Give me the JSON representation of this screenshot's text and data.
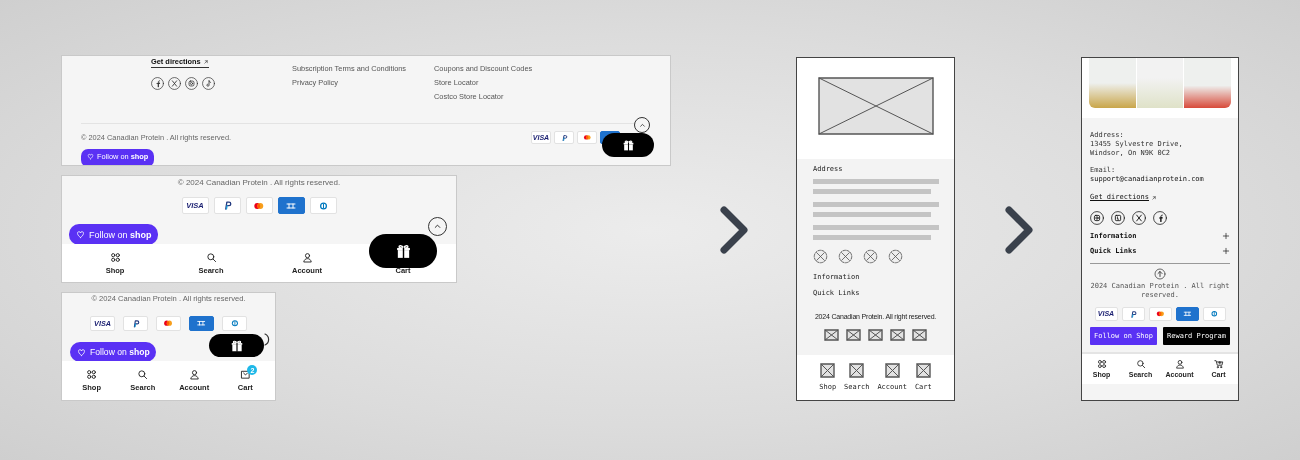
{
  "desktop_footer": {
    "get_directions": "Get directions",
    "links_column_1": [
      "Subscription Terms and Conditions",
      "Privacy Policy"
    ],
    "links_column_2": [
      "Coupons and Discount Codes",
      "Store Locator",
      "Costco Store Locator"
    ],
    "copyright": "© 2024 Canadian Protein . All rights reserved.",
    "payment_methods": [
      {
        "kind": "visa",
        "text": "VISA"
      },
      {
        "kind": "paypal"
      },
      {
        "kind": "mastercard"
      },
      {
        "kind": "amex"
      }
    ],
    "follow_button": "Follow on **shop**"
  },
  "tablet_footer": {
    "copyright": "© 2024 Canadian Protein . All rights reserved.",
    "payment_methods": [
      {
        "kind": "visa",
        "text": "VISA"
      },
      {
        "kind": "paypal"
      },
      {
        "kind": "mastercard"
      },
      {
        "kind": "amex"
      },
      {
        "kind": "diners"
      }
    ],
    "follow_button": "Follow on **shop**",
    "nav": [
      {
        "kind": "shop",
        "label": "Shop"
      },
      {
        "kind": "search",
        "label": "Search"
      },
      {
        "kind": "account",
        "label": "Account"
      },
      {
        "kind": "cart",
        "label": "Cart"
      }
    ]
  },
  "phone_footer": {
    "copyright": "© 2024 Canadian Protein . All rights reserved.",
    "payment_methods": [
      {
        "kind": "visa",
        "text": "VISA"
      },
      {
        "kind": "paypal"
      },
      {
        "kind": "mastercard"
      },
      {
        "kind": "amex"
      },
      {
        "kind": "diners"
      }
    ],
    "follow_button": "Follow on **shop**",
    "nav": [
      {
        "kind": "shop",
        "label": "Shop"
      },
      {
        "kind": "search",
        "label": "Search"
      },
      {
        "kind": "account",
        "label": "Account"
      },
      {
        "kind": "cart",
        "label": "Cart",
        "badge": "2"
      }
    ]
  },
  "wireframe": {
    "address_label": "Address",
    "sections": [
      "Information",
      "Quick Links"
    ],
    "copyright": "2024 Canadian Protein. All right reserved.",
    "nav": [
      "Shop",
      "Search",
      "Account",
      "Cart"
    ]
  },
  "mobile_footer": {
    "address_label": "Address:",
    "address_lines": [
      "13455 Sylvestre Drive,",
      "Windsor, On N9K 0C2"
    ],
    "email_label": "Email:",
    "email": "support@canadianprotein.com",
    "get_directions": "Get directions",
    "sections": [
      {
        "label": "Information",
        "expanded": false
      },
      {
        "label": "Quick Links",
        "expanded": false
      }
    ],
    "copyright": "2024 Canadian Protein . All right reserved.",
    "payment_methods": [
      {
        "kind": "visa",
        "text": "VISA"
      },
      {
        "kind": "paypal"
      },
      {
        "kind": "mastercard"
      },
      {
        "kind": "amex"
      },
      {
        "kind": "diners"
      }
    ],
    "buttons": [
      {
        "kind": "follow",
        "label": "Follow on Shop"
      },
      {
        "kind": "reward",
        "label": "Reward Program"
      }
    ],
    "nav": [
      {
        "kind": "shop",
        "label": "Shop"
      },
      {
        "kind": "search",
        "label": "Search"
      },
      {
        "kind": "account",
        "label": "Account"
      },
      {
        "kind": "cart",
        "label": "Cart"
      }
    ]
  }
}
